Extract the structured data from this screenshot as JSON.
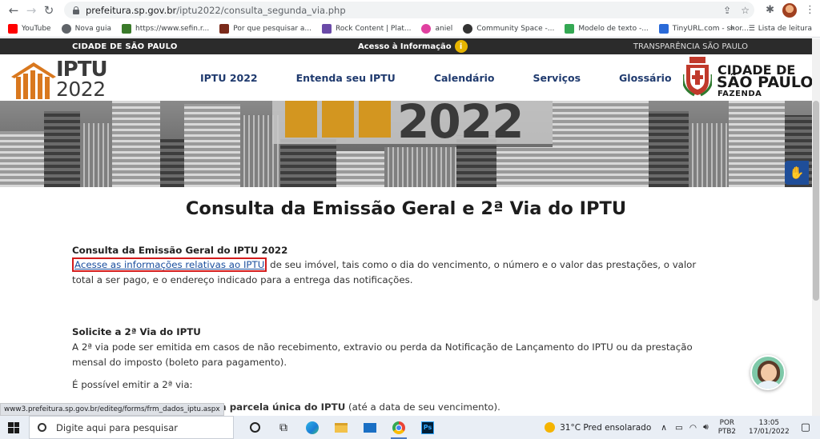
{
  "browser": {
    "url_host": "prefeitura.sp.gov.br",
    "url_path": "/iptu2022/consulta_segunda_via.php",
    "bookmarks": [
      {
        "label": "YouTube",
        "color": "#ff0000"
      },
      {
        "label": "Nova guia",
        "color": "#5f6368"
      },
      {
        "label": "https://www.sefin.r...",
        "color": "#3a7a2a"
      },
      {
        "label": "Por que pesquisar a...",
        "color": "#7a2a1a"
      },
      {
        "label": "Rock Content | Plat...",
        "color": "#6a4aa8"
      },
      {
        "label": "aniel",
        "color": "#e040a0"
      },
      {
        "label": "Community Space -...",
        "color": "#333333"
      },
      {
        "label": "Modelo de texto -...",
        "color": "#34a853"
      },
      {
        "label": "TinyURL.com - shor...",
        "color": "#2a6ad8"
      }
    ],
    "bookmarks_more": "»",
    "reading_list": "Lista de leitura",
    "status_url": "www3.prefeitura.sp.gov.br/editeg/forms/frm_dados_iptu.aspx"
  },
  "site": {
    "top_left": "CIDADE DE SÃO PAULO",
    "top_mid": "Acesso à Informação",
    "top_right": "TRANSPARÊNCIA SÃO PAULO",
    "logo_line1": "IPTU",
    "logo_line2": "2022",
    "nav": [
      "IPTU 2022",
      "Entenda seu IPTU",
      "Calendário",
      "Serviços",
      "Glossário"
    ],
    "csp_line1": "CIDADE DE",
    "csp_line2": "SÃO PAULO",
    "csp_line3": "FAZENDA",
    "banner_year": "2022"
  },
  "content": {
    "title": "Consulta da Emissão Geral e 2ª Via do IPTU",
    "s1_title": "Consulta da Emissão Geral do IPTU 2022",
    "s1_link": "Acesse as informações relativas ao IPTU",
    "s1_text_rest": " de seu imóvel, tais como o dia do vencimento, o número e o valor das prestações, o valor total a ser pago, e o endereço indicado para a entrega das notificações.",
    "s2_title": "Solicite a 2ª Via do IPTU",
    "s2_text": "A 2ª via pode ser emitida em casos de não recebimento, extravio ou perda da Notificação de Lançamento do IPTU ou da prestação mensal do imposto (boleto para pagamento).",
    "s2_text2": "É possível emitir a 2ª via:",
    "s2_cut_bold": "o da parcela única do IPTU",
    "s2_cut_rest": " (até a data de seu vencimento)."
  },
  "taskbar": {
    "search_placeholder": "Digite aqui para pesquisar",
    "weather": "31°C  Pred ensolarado",
    "lang1": "POR",
    "lang2": "PTB2",
    "time": "13:05",
    "date": "17/01/2022"
  }
}
